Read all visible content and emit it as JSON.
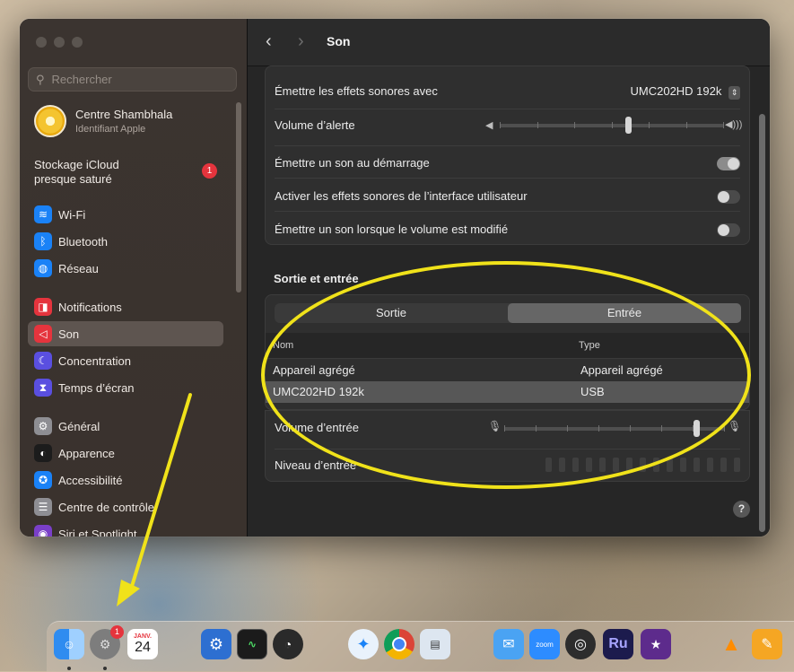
{
  "window": {
    "title": "Son"
  },
  "sidebar": {
    "search_placeholder": "Rechercher",
    "profile": {
      "name": "Centre Shambhala",
      "subtitle": "Identifiant Apple"
    },
    "icloud": {
      "line1": "Stockage iCloud",
      "line2": "presque saturé",
      "badge": "1"
    },
    "items": [
      {
        "label": "Wi-Fi",
        "icon": "wifi-icon",
        "color": "#1a82f7",
        "glyph": "≋"
      },
      {
        "label": "Bluetooth",
        "icon": "bluetooth-icon",
        "color": "#1a82f7",
        "glyph": "ᛒ"
      },
      {
        "label": "Réseau",
        "icon": "network-icon",
        "color": "#1a82f7",
        "glyph": "◍"
      },
      {
        "label": "Notifications",
        "icon": "notifications-icon",
        "color": "#e5343d",
        "glyph": "◨"
      },
      {
        "label": "Son",
        "icon": "sound-icon",
        "color": "#e5343d",
        "glyph": "◁"
      },
      {
        "label": "Concentration",
        "icon": "focus-icon",
        "color": "#5a4fe0",
        "glyph": "☾"
      },
      {
        "label": "Temps d’écran",
        "icon": "screen-time-icon",
        "color": "#5a4fe0",
        "glyph": "⧗"
      },
      {
        "label": "Général",
        "icon": "general-icon",
        "color": "#8e8e93",
        "glyph": "⚙"
      },
      {
        "label": "Apparence",
        "icon": "appearance-icon",
        "color": "#1c1c1c",
        "glyph": "◐"
      },
      {
        "label": "Accessibilité",
        "icon": "accessibility-icon",
        "color": "#1a82f7",
        "glyph": "✪"
      },
      {
        "label": "Centre de contrôle",
        "icon": "control-center-icon",
        "color": "#8e8e93",
        "glyph": "☰"
      },
      {
        "label": "Siri et Spotlight",
        "icon": "siri-icon",
        "color": "#7a3fc8",
        "glyph": "◉"
      }
    ]
  },
  "effects": {
    "output_label": "Émettre les effets sonores avec",
    "output_value": "UMC202HD 192k",
    "alert_volume_label": "Volume d’alerte",
    "alert_volume_level": 0.57,
    "startup_label": "Émettre un son au démarrage",
    "startup_on": true,
    "ui_sounds_label": "Activer les effets sonores de l’interface utilisateur",
    "ui_sounds_on": false,
    "volume_feedback_label": "Émettre un son lorsque le volume est modifié",
    "volume_feedback_on": false
  },
  "io": {
    "section_title": "Sortie et entrée",
    "tabs": {
      "output": "Sortie",
      "input": "Entrée",
      "selected": "input"
    },
    "columns": {
      "name": "Nom",
      "type": "Type"
    },
    "rows": [
      {
        "name": "Appareil agrégé",
        "type": "Appareil agrégé",
        "selected": false
      },
      {
        "name": "UMC202HD 192k",
        "type": "USB",
        "selected": true
      }
    ],
    "input_volume_label": "Volume d’entrée",
    "input_volume_level": 0.87,
    "input_level_label": "Niveau d’entrée",
    "input_level_segments": 15
  },
  "help": "?",
  "dock": {
    "settings_badge": "1",
    "calendar_month": "JANV.",
    "calendar_day": "24",
    "zoom_label": "zoom",
    "ru_label": "Ru"
  }
}
